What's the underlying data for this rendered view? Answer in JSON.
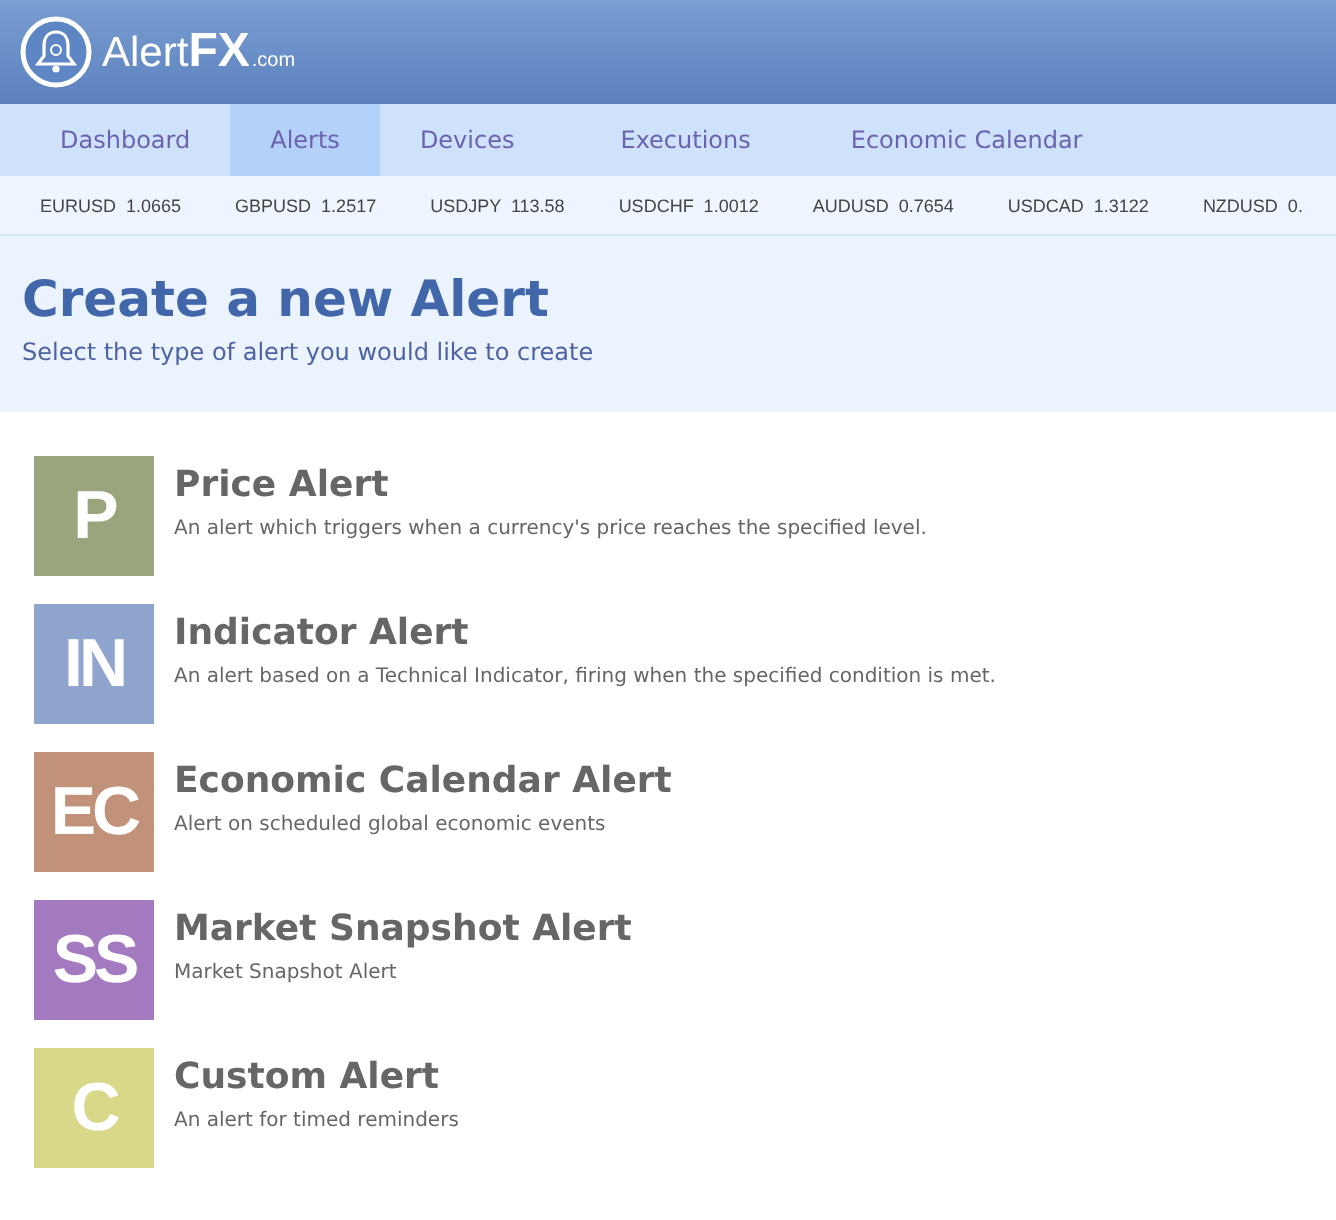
{
  "header": {
    "logo": {
      "name": "Alert",
      "brand": "FX",
      "suffix": ".com"
    }
  },
  "nav": [
    {
      "label": "Dashboard",
      "selected": false
    },
    {
      "label": "Alerts",
      "selected": true
    },
    {
      "label": "Devices",
      "selected": false
    },
    {
      "label": "Executions",
      "selected": false
    },
    {
      "label": "Economic Calendar",
      "selected": false
    }
  ],
  "ticker": [
    {
      "pair": "EURUSD",
      "price": "1.0665"
    },
    {
      "pair": "GBPUSD",
      "price": "1.2517"
    },
    {
      "pair": "USDJPY",
      "price": "113.58"
    },
    {
      "pair": "USDCHF",
      "price": "1.0012"
    },
    {
      "pair": "AUDUSD",
      "price": "0.7654"
    },
    {
      "pair": "USDCAD",
      "price": "1.3122"
    },
    {
      "pair": "NZDUSD",
      "price": "0."
    }
  ],
  "page": {
    "title": "Create a new Alert",
    "subtitle": "Select the type of alert you would like to create"
  },
  "alert_types": [
    {
      "badge": "P",
      "title": "Price Alert",
      "description": "An alert which triggers when a currency's price reaches the specified level.",
      "color": "#9ba57d"
    },
    {
      "badge": "IN",
      "title": "Indicator Alert",
      "description": "An alert based on a Technical Indicator, firing when the specified condition is met.",
      "color": "#8fa5cd"
    },
    {
      "badge": "EC",
      "title": "Economic Calendar Alert",
      "description": "Alert on scheduled global economic events",
      "color": "#c29179"
    },
    {
      "badge": "SS",
      "title": "Market Snapshot Alert",
      "description": "Market Snapshot Alert",
      "color": "#a37ac0"
    },
    {
      "badge": "C",
      "title": "Custom Alert",
      "description": "An alert for timed reminders",
      "color": "#d7d888"
    }
  ]
}
